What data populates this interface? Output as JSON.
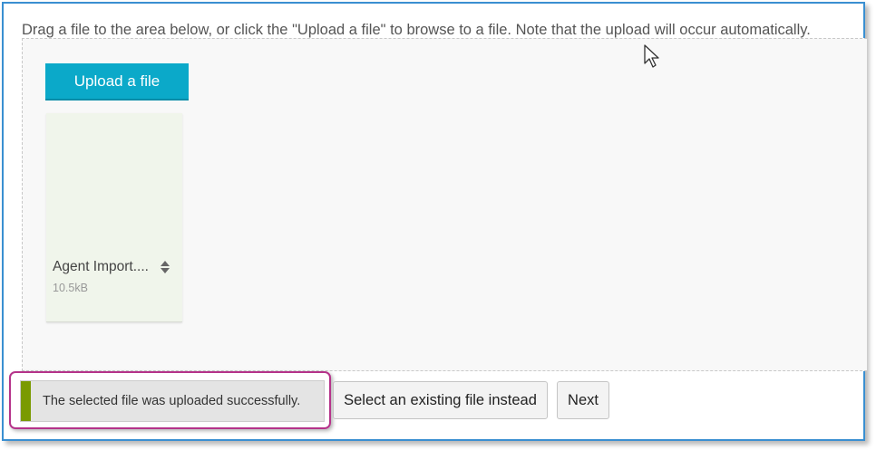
{
  "instructions": "Drag a file to the area below, or click the \"Upload a file\" to browse to a file. Note that the upload will occur automatically.",
  "upload_button_label": "Upload a file",
  "file": {
    "name": "Agent Import....",
    "size": "10.5kB",
    "icon": "sort-icon"
  },
  "status": {
    "message": "The selected file was uploaded successfully.",
    "accent_color": "#7a9a01",
    "highlight_color": "#b5338a"
  },
  "actions": {
    "select_existing_label": "Select an existing file instead",
    "next_label": "Next"
  },
  "colors": {
    "upload_button": "#0ba9c9",
    "frame_border": "#3a8fd1"
  }
}
